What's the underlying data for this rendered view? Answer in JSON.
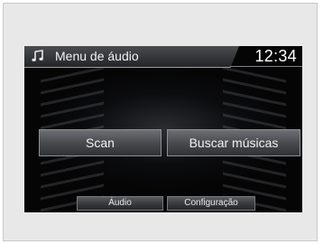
{
  "header": {
    "title": "Menu de áudio",
    "time": "12:34",
    "icon": "music-note-icon"
  },
  "main": {
    "buttons": [
      {
        "label": "Scan"
      },
      {
        "label": "Buscar músicas"
      }
    ]
  },
  "footer": {
    "tabs": [
      {
        "label": "Áudio"
      },
      {
        "label": "Configuração"
      }
    ]
  },
  "colors": {
    "screen_background": "#050506",
    "button_top": "#6c6f74",
    "button_bottom": "#2f3134",
    "text": "#f3f3f3",
    "frame": "#e8e8e8"
  }
}
